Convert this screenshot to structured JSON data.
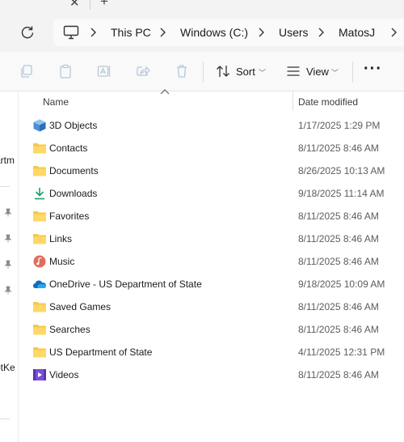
{
  "addressbar": {
    "breadcrumbs": [
      "This PC",
      "Windows (C:)",
      "Users",
      "MatosJ"
    ]
  },
  "commandbar": {
    "sort_label": "Sort",
    "view_label": "View",
    "more_label": "···"
  },
  "navpane": {
    "fragments": [
      "artm",
      "otKe"
    ]
  },
  "columns": {
    "name": "Name",
    "date_modified": "Date modified"
  },
  "files": [
    {
      "name": "3D Objects",
      "date": "1/17/2025 1:29 PM",
      "icon": "3d-objects-icon"
    },
    {
      "name": "Contacts",
      "date": "8/11/2025 8:46 AM",
      "icon": "folder-icon"
    },
    {
      "name": "Documents",
      "date": "8/26/2025 10:13 AM",
      "icon": "folder-icon"
    },
    {
      "name": "Downloads",
      "date": "9/18/2025 11:14 AM",
      "icon": "download-icon"
    },
    {
      "name": "Favorites",
      "date": "8/11/2025 8:46 AM",
      "icon": "folder-icon"
    },
    {
      "name": "Links",
      "date": "8/11/2025 8:46 AM",
      "icon": "folder-icon"
    },
    {
      "name": "Music",
      "date": "8/11/2025 8:46 AM",
      "icon": "music-icon"
    },
    {
      "name": "OneDrive - US Department of State",
      "date": "9/18/2025 10:09 AM",
      "icon": "onedrive-cloud-icon"
    },
    {
      "name": "Saved Games",
      "date": "8/11/2025 8:46 AM",
      "icon": "folder-icon"
    },
    {
      "name": "Searches",
      "date": "8/11/2025 8:46 AM",
      "icon": "folder-icon"
    },
    {
      "name": "US Department of State",
      "date": "4/11/2025 12:31 PM",
      "icon": "folder-icon"
    },
    {
      "name": "Videos",
      "date": "8/11/2025 8:46 AM",
      "icon": "videos-icon"
    }
  ],
  "colors": {
    "folder": "#f8c74a",
    "accent": "#0067c0",
    "onedrive": "#0f6cbd"
  }
}
